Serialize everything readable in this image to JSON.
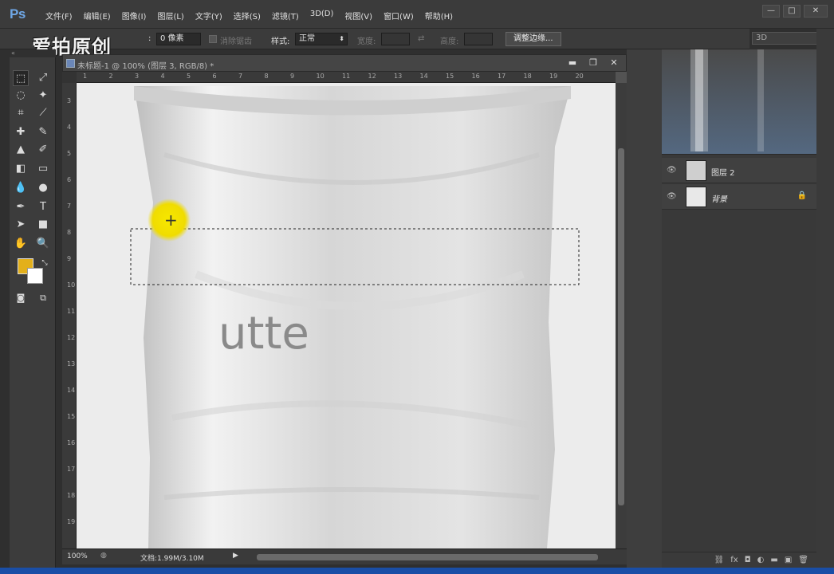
{
  "app": {
    "logo": "Ps"
  },
  "menu": [
    "文件(F)",
    "编辑(E)",
    "图像(I)",
    "图层(L)",
    "文字(Y)",
    "选择(S)",
    "滤镜(T)",
    "3D(D)",
    "视图(V)",
    "窗口(W)",
    "帮助(H)"
  ],
  "window_controls": {
    "minimize": "—",
    "restore": "□",
    "close": "✕"
  },
  "options": {
    "watermark": "爱拍原创",
    "feather_label": ":",
    "feather_value": "0 像素",
    "antialias_label": "消除锯齿",
    "style_label": "样式:",
    "style_value": "正常",
    "width_label": "宽度:",
    "height_label": "高度:",
    "refine_edge_button": "调整边缘..."
  },
  "panel_3d_dropdown": "3D",
  "panel_collapse": "«",
  "tools": [
    "selection",
    "move",
    "lasso",
    "magic-wand",
    "crop",
    "eyedropper",
    "healing",
    "brush",
    "stamp",
    "history-brush",
    "eraser",
    "gradient",
    "blur",
    "dodge",
    "pen",
    "type",
    "path-select",
    "shape",
    "hand",
    "zoom"
  ],
  "colors": {
    "foreground": "#e3b01b",
    "background": "#ffffff",
    "highlight": "#f2e200"
  },
  "document": {
    "title": "未标题-1 @ 100% (图层 3, RGB/8) *",
    "minimize": "▬",
    "restore": "❐",
    "close": "✕",
    "ruler_h": [
      "1",
      "2",
      "3",
      "4",
      "5",
      "6",
      "7",
      "8",
      "9",
      "10",
      "11",
      "12",
      "13",
      "14",
      "15",
      "16",
      "17",
      "18",
      "19",
      "20"
    ],
    "ruler_v": [
      "3",
      "4",
      "5",
      "6",
      "7",
      "8",
      "9",
      "10",
      "11",
      "12",
      "13",
      "14",
      "15",
      "16",
      "17",
      "18",
      "19"
    ],
    "canvas_text": "utte",
    "crosshair": "+"
  },
  "status": {
    "zoom": "100%",
    "doc_info": "文档:1.99M/3.10M",
    "arrow": "▶"
  },
  "layers": [
    {
      "name": "图层 2",
      "italic": false,
      "locked": false
    },
    {
      "name": "背景",
      "italic": true,
      "locked": true
    }
  ],
  "layer_icons": {
    "eye": "👁",
    "lock": "🔒"
  },
  "layers_footer": [
    "⛓",
    "fx",
    "◘",
    "◐",
    "▬",
    "▣",
    "🗑"
  ]
}
